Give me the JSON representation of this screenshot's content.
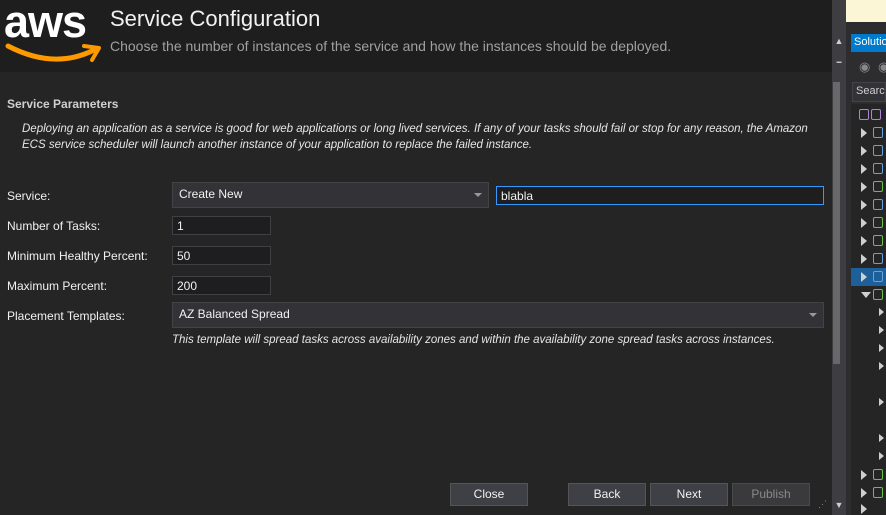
{
  "header": {
    "logo_text": "aws",
    "title": "Service Configuration",
    "subtitle": "Choose the number of instances of the service and how the instances should be deployed."
  },
  "section": {
    "title": "Service Parameters",
    "description": "Deploying an application as a service is good for web applications or long lived services. If any of your tasks should fail or stop for any reason, the Amazon ECS service scheduler will launch another instance of your application to replace the failed instance."
  },
  "form": {
    "service_label": "Service:",
    "service_value": "Create New",
    "service_name_value": "blabla",
    "tasks_label": "Number of Tasks:",
    "tasks_value": "1",
    "min_healthy_label": "Minimum Healthy Percent:",
    "min_healthy_value": "50",
    "max_percent_label": "Maximum Percent:",
    "max_percent_value": "200",
    "placement_label": "Placement Templates:",
    "placement_value": "AZ Balanced Spread",
    "placement_note": "This template will spread tasks across availability zones and within the availability zone spread tasks across instances."
  },
  "buttons": {
    "close": "Close",
    "back": "Back",
    "next": "Next",
    "publish": "Publish"
  },
  "solution_explorer": {
    "tab_label": "Solution Explorer",
    "search_placeholder": "Search Solution Explorer"
  },
  "colors": {
    "accent": "#007acc",
    "aws_orange": "#ff9900",
    "focus_border": "#3399ff"
  }
}
